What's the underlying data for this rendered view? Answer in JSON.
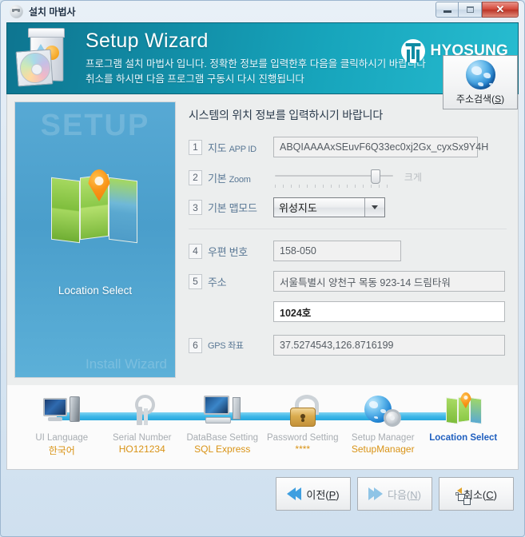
{
  "window": {
    "title": "설치 마법사",
    "title_icon": "setup-disc-icon",
    "controls": {
      "minimize": "minimize-icon",
      "maximize": "maximize-icon",
      "close": "close-icon"
    }
  },
  "banner": {
    "icon": "software-box-cd-icon",
    "title": "Setup Wizard",
    "line1": "프로그램 설치 마법사 입니다. 정확한 정보를 입력한후 다음을 클릭하시기 바랍니다",
    "line2": "취소를 하시면 다음 프로그램 구동시 다시 진행됩니다",
    "brand": "HYOSUNG",
    "brand_color": "#0f8ba3",
    "bg_color": "#128fa8"
  },
  "side_panel": {
    "watermark_top": "SETUP",
    "watermark_bottom": "Install Wizard",
    "caption": "Location Select",
    "icon": "map-pin-icon",
    "bg_color": "#4a9ecb"
  },
  "form": {
    "heading": "시스템의 위치 정보를 입력하시기 바랍니다",
    "fields": [
      {
        "num": "1",
        "label_main": "지도 ",
        "label_sub": "APP ID",
        "value": "ABQIAAAAxSEuvF6Q33ec0xj2Gx_cyxSx9Y4H"
      },
      {
        "num": "2",
        "label_main": "기본 ",
        "label_sub": "Zoom",
        "slider_max_label": "크게"
      },
      {
        "num": "3",
        "label_main": "기본 맵모드",
        "label_sub": "",
        "value": "위성지도"
      },
      {
        "num": "4",
        "label_main": "우편 번호",
        "label_sub": "",
        "value": "158-050"
      },
      {
        "num": "5",
        "label_main": "주소",
        "label_sub": "",
        "value": "서울특별시 양천구 목동 923-14 드림타워",
        "value2": "1024호"
      },
      {
        "num": "6",
        "label_main": "",
        "label_sub": "GPS 좌표",
        "value": "37.5274543,126.8716199"
      }
    ],
    "address_search_button": {
      "label_pre": "주소검색(",
      "accel": "S",
      "label_post": ")",
      "icon": "globe-icon"
    }
  },
  "steps": [
    {
      "name": "UI Language",
      "value": "한국어",
      "icon": "desktop-pc-icon",
      "current": false
    },
    {
      "name": "Serial Number",
      "value": "HO121234",
      "icon": "keys-icon",
      "current": false
    },
    {
      "name": "DataBase Setting",
      "value": "SQL Express",
      "icon": "database-pc-icon",
      "current": false
    },
    {
      "name": "Password Setting",
      "value": "****",
      "icon": "padlock-icon",
      "current": false
    },
    {
      "name": "Setup Manager",
      "value": "SetupManager",
      "icon": "globe-gear-icon",
      "current": false
    },
    {
      "name": "Location Select",
      "value": "",
      "icon": "map-pin-icon",
      "current": true
    }
  ],
  "step_colors": {
    "line": "#3fb8e8",
    "value": "#d99316",
    "current_text": "#1f5fbf",
    "inactive_text": "#a8adb2"
  },
  "footer": {
    "prev": {
      "label_pre": "이전(",
      "accel": "P",
      "label_post": ")",
      "icon": "double-arrow-left-icon",
      "disabled": false
    },
    "next": {
      "label_pre": "다음(",
      "accel": "N",
      "label_post": ")",
      "icon": "double-arrow-right-icon",
      "disabled": true
    },
    "cancel": {
      "label_pre": "취소(",
      "accel": "C",
      "label_post": ")",
      "icon": "cancel-windows-icon",
      "disabled": false
    }
  }
}
